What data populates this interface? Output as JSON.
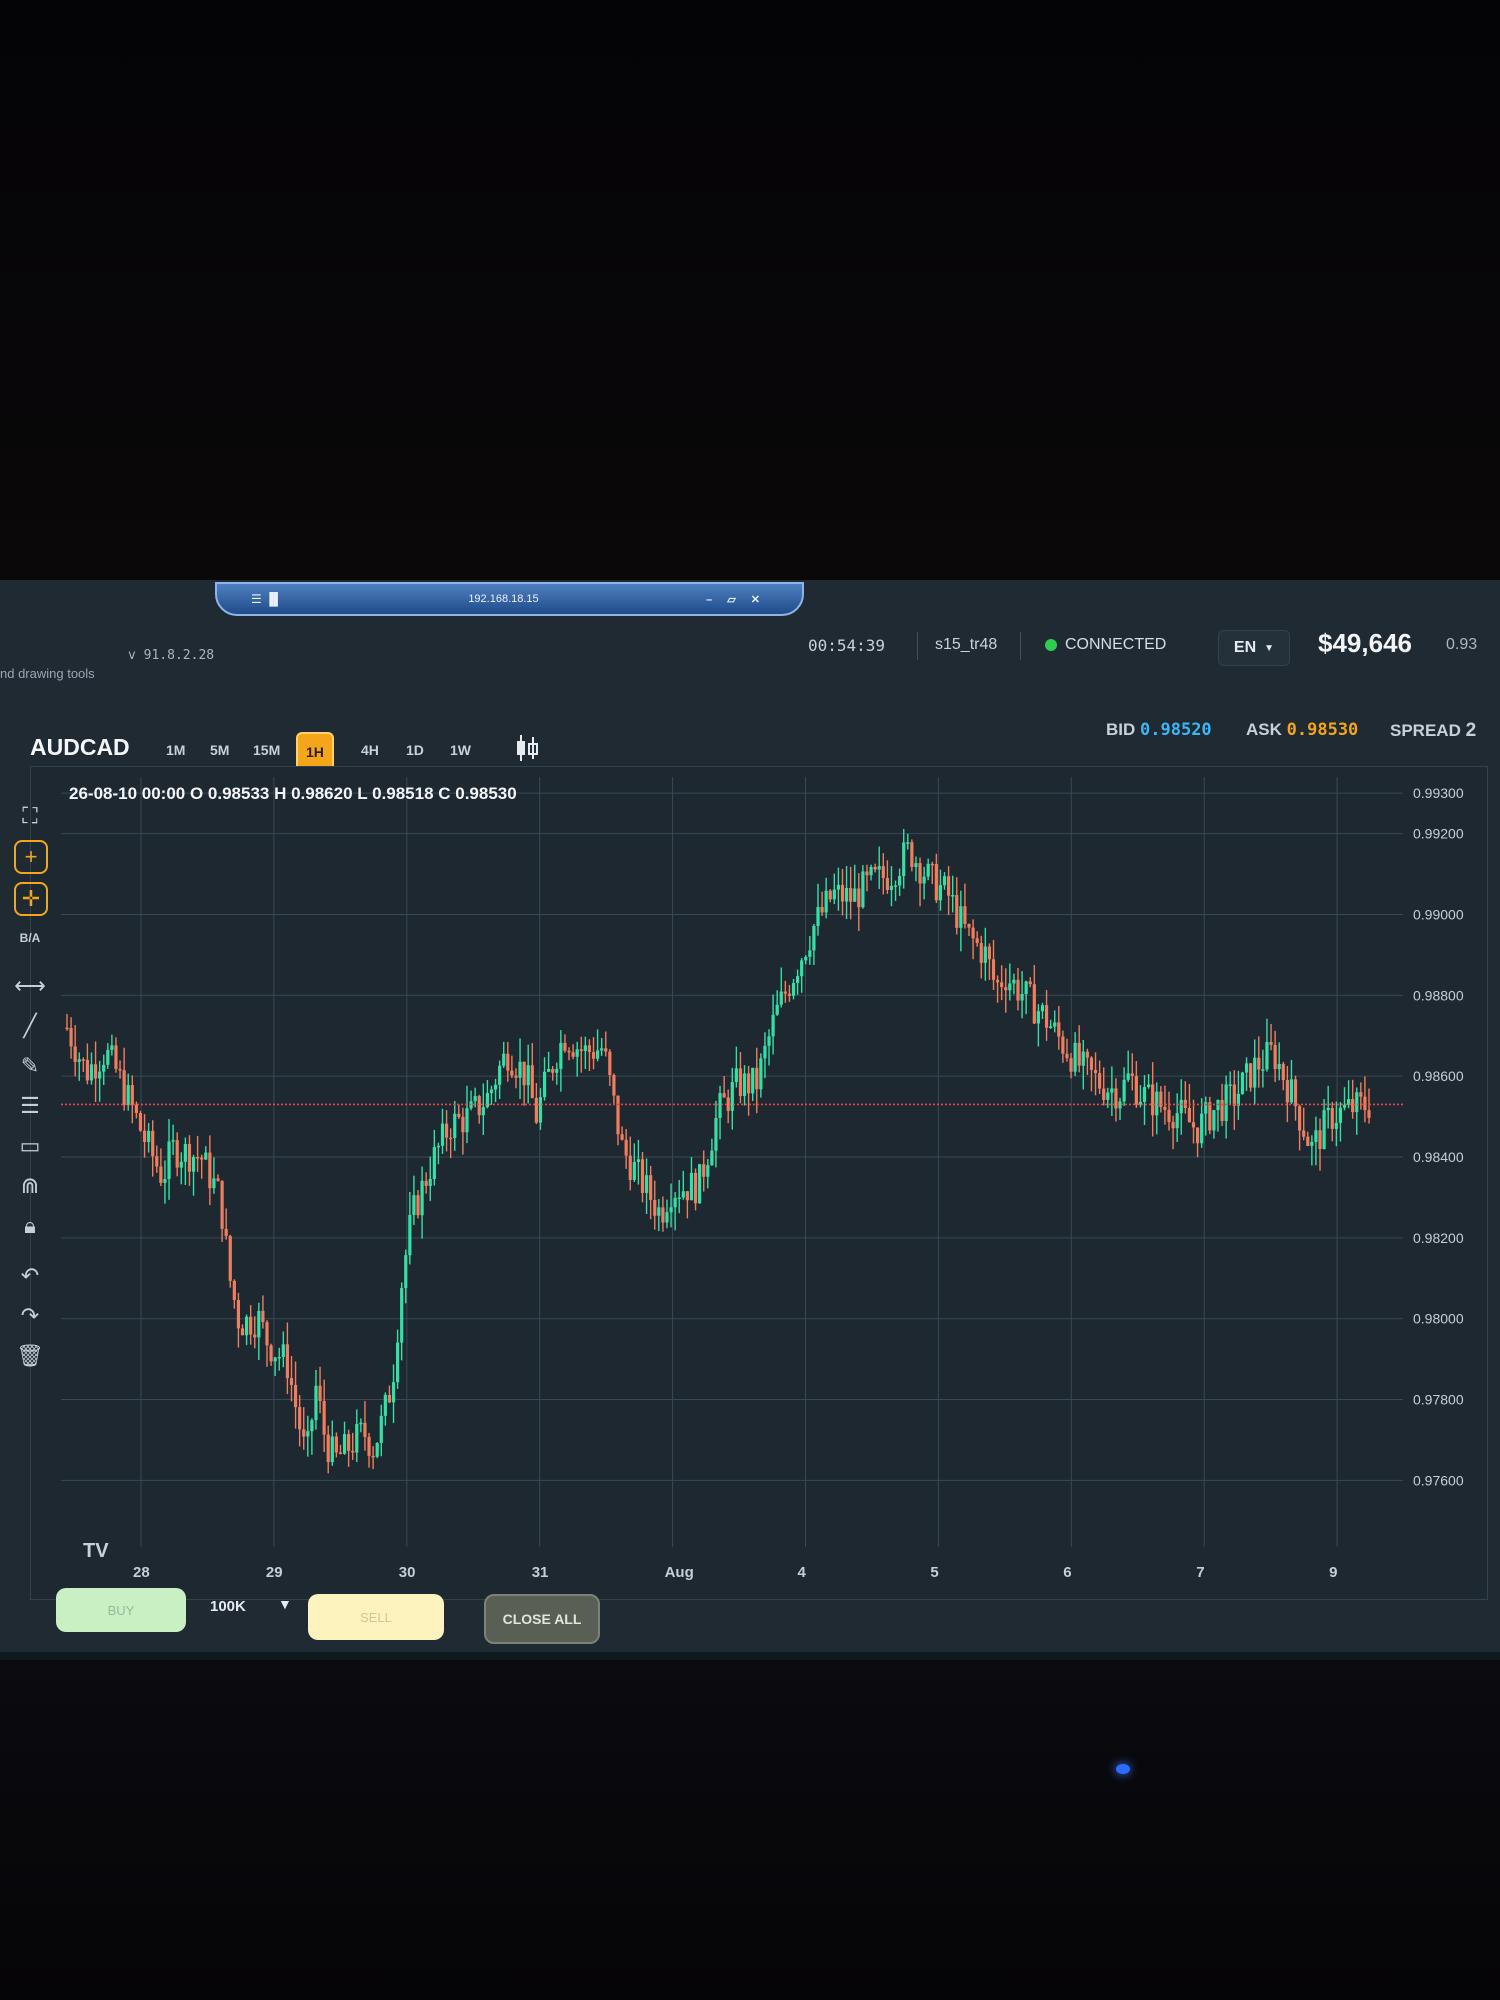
{
  "remote_desktop": {
    "signal_label": "☰ ▐▌",
    "host": "192.168.18.15",
    "controls": "– ▱ ✕"
  },
  "header": {
    "subtitle": "nd drawing tools",
    "version": "v 91.8.2.28",
    "clock": "00:54:39",
    "user": "s15_tr48",
    "status": "CONNECTED",
    "language": "EN",
    "balance": "$49,646",
    "balance_extra": "0.93",
    "status_color": "#2fcc4f"
  },
  "toolbar": {
    "symbol": "AUDCAD",
    "timeframes": [
      "1M",
      "5M",
      "15M",
      "1H",
      "4H",
      "1D",
      "1W"
    ],
    "active_timeframe": "1H",
    "chart_type_icon": "candlestick-icon",
    "bid_label": "BID",
    "bid": "0.98520",
    "ask_label": "ASK",
    "ask": "0.98530",
    "spread_label": "SPREAD",
    "spread": "2",
    "bid_color": "#3bb7f5",
    "ask_color": "#f5a51a"
  },
  "tools": {
    "labels": [
      "fullscreen-icon",
      "crosshair-icon",
      "move-icon",
      "B/A",
      "horizontal-line-icon",
      "trend-line-icon",
      "pencil-icon",
      "fib-lines-icon",
      "rectangle-icon",
      "magnet-icon",
      "lock-icon",
      "undo-icon",
      "redo-icon",
      "trash-icon"
    ],
    "ba_label": "B/A"
  },
  "chart_data": {
    "type": "candlestick",
    "symbol": "AUDCAD",
    "timeframe": "1H",
    "ohlc_header": "26-08-10 00:00 O 0.98533 H 0.98620 L 0.98518 C 0.98530",
    "y_ticks": [
      "0.99300",
      "0.99200",
      "0.99000",
      "0.98800",
      "0.98600",
      "0.98400",
      "0.98200",
      "0.98000",
      "0.97800",
      "0.97600"
    ],
    "y_tick_values": [
      0.993,
      0.992,
      0.99,
      0.988,
      0.986,
      0.984,
      0.982,
      0.98,
      0.978,
      0.976
    ],
    "x_ticks": [
      "28",
      "29",
      "30",
      "31",
      "Aug",
      "4",
      "5",
      "6",
      "7",
      "9"
    ],
    "ylim": [
      0.9746,
      0.9934
    ],
    "current_price": 0.9853,
    "price_line_color": "#e8484a",
    "up_color": "#35e0a8",
    "down_color": "#f07e5e",
    "price_path": [
      [
        0.0,
        0.9872
      ],
      [
        1.0,
        0.9861
      ],
      [
        2.0,
        0.9866
      ],
      [
        2.5,
        0.9862
      ],
      [
        3.5,
        0.9851
      ],
      [
        4.0,
        0.9845
      ],
      [
        5.0,
        0.9835
      ],
      [
        5.5,
        0.9842
      ],
      [
        7.0,
        0.984
      ],
      [
        8.0,
        0.983
      ],
      [
        8.5,
        0.981
      ],
      [
        9.0,
        0.9799
      ],
      [
        10.0,
        0.98
      ],
      [
        10.5,
        0.9794
      ],
      [
        11.5,
        0.9789
      ],
      [
        12.5,
        0.9765
      ],
      [
        13.0,
        0.9783
      ],
      [
        13.5,
        0.977
      ],
      [
        14.0,
        0.9765
      ],
      [
        15.5,
        0.9772
      ],
      [
        16.0,
        0.9768
      ],
      [
        16.5,
        0.9775
      ],
      [
        17.0,
        0.9785
      ],
      [
        17.5,
        0.981
      ],
      [
        18.0,
        0.9825
      ],
      [
        19.0,
        0.9838
      ],
      [
        20.0,
        0.9848
      ],
      [
        21.0,
        0.985
      ],
      [
        22.0,
        0.9855
      ],
      [
        22.5,
        0.9861
      ],
      [
        23.0,
        0.9866
      ],
      [
        24.0,
        0.986
      ],
      [
        24.5,
        0.985
      ],
      [
        25.0,
        0.9858
      ],
      [
        25.5,
        0.9865
      ],
      [
        26.0,
        0.987
      ],
      [
        27.0,
        0.9866
      ],
      [
        28.0,
        0.9867
      ],
      [
        29.0,
        0.9842
      ],
      [
        30.0,
        0.9834
      ],
      [
        31.0,
        0.9826
      ],
      [
        31.5,
        0.9832
      ],
      [
        33.0,
        0.9833
      ],
      [
        34.0,
        0.9851
      ],
      [
        35.0,
        0.9858
      ],
      [
        36.0,
        0.9858
      ],
      [
        37.0,
        0.9875
      ],
      [
        38.0,
        0.9886
      ],
      [
        39.0,
        0.9897
      ],
      [
        40.0,
        0.9905
      ],
      [
        41.0,
        0.9904
      ],
      [
        42.0,
        0.9908
      ],
      [
        43.0,
        0.991
      ],
      [
        44.0,
        0.9916
      ],
      [
        45.0,
        0.9909
      ],
      [
        46.0,
        0.9905
      ],
      [
        47.0,
        0.9895
      ],
      [
        48.0,
        0.989
      ],
      [
        48.5,
        0.9882
      ],
      [
        49.0,
        0.9885
      ],
      [
        50.0,
        0.988
      ],
      [
        51.0,
        0.9875
      ],
      [
        52.0,
        0.9868
      ],
      [
        53.0,
        0.9862
      ],
      [
        54.0,
        0.9858
      ],
      [
        55.0,
        0.9856
      ],
      [
        55.5,
        0.986
      ],
      [
        56.0,
        0.9856
      ],
      [
        57.0,
        0.9853
      ],
      [
        58.0,
        0.9851
      ],
      [
        59.0,
        0.9847
      ],
      [
        60.0,
        0.9852
      ],
      [
        61.0,
        0.9855
      ],
      [
        62.0,
        0.9862
      ],
      [
        63.0,
        0.9866
      ],
      [
        64.0,
        0.9855
      ],
      [
        65.0,
        0.9842
      ],
      [
        66.0,
        0.985
      ],
      [
        67.0,
        0.9852
      ],
      [
        68.0,
        0.9853
      ]
    ]
  },
  "actions": {
    "buy": "BUY",
    "lot": "100K",
    "sell": "SELL",
    "close_all": "CLOSE ALL"
  }
}
